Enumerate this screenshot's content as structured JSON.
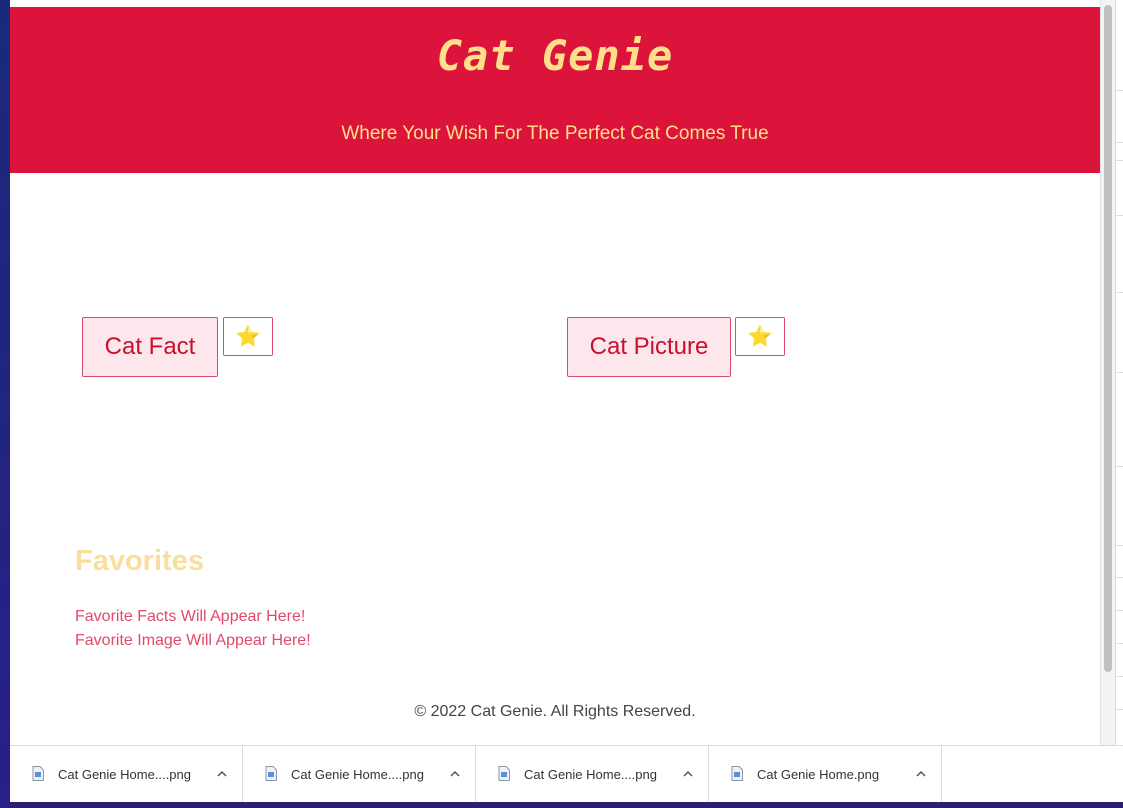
{
  "header": {
    "title": "Cat Genie",
    "subtitle": "Where Your Wish For The Perfect Cat Comes True"
  },
  "actions": {
    "cat_fact_label": "Cat Fact",
    "cat_picture_label": "Cat Picture",
    "star_icon": "⭐"
  },
  "favorites": {
    "title": "Favorites",
    "facts_placeholder": "Favorite Facts Will Appear Here!",
    "image_placeholder": "Favorite Image Will Appear Here!"
  },
  "footer": {
    "copyright": "© 2022 Cat Genie. All Rights Reserved."
  },
  "downloads": [
    {
      "name": "Cat Genie Home....png"
    },
    {
      "name": "Cat Genie Home....png"
    },
    {
      "name": "Cat Genie Home....png"
    },
    {
      "name": "Cat Genie Home.png"
    }
  ],
  "colors": {
    "header_bg": "#dc143c",
    "title_text": "#ffe08a",
    "button_bg": "#fde7ec",
    "button_text": "#c8102e",
    "favorites_title": "#fadf9c",
    "favorites_text": "#e2496b"
  }
}
